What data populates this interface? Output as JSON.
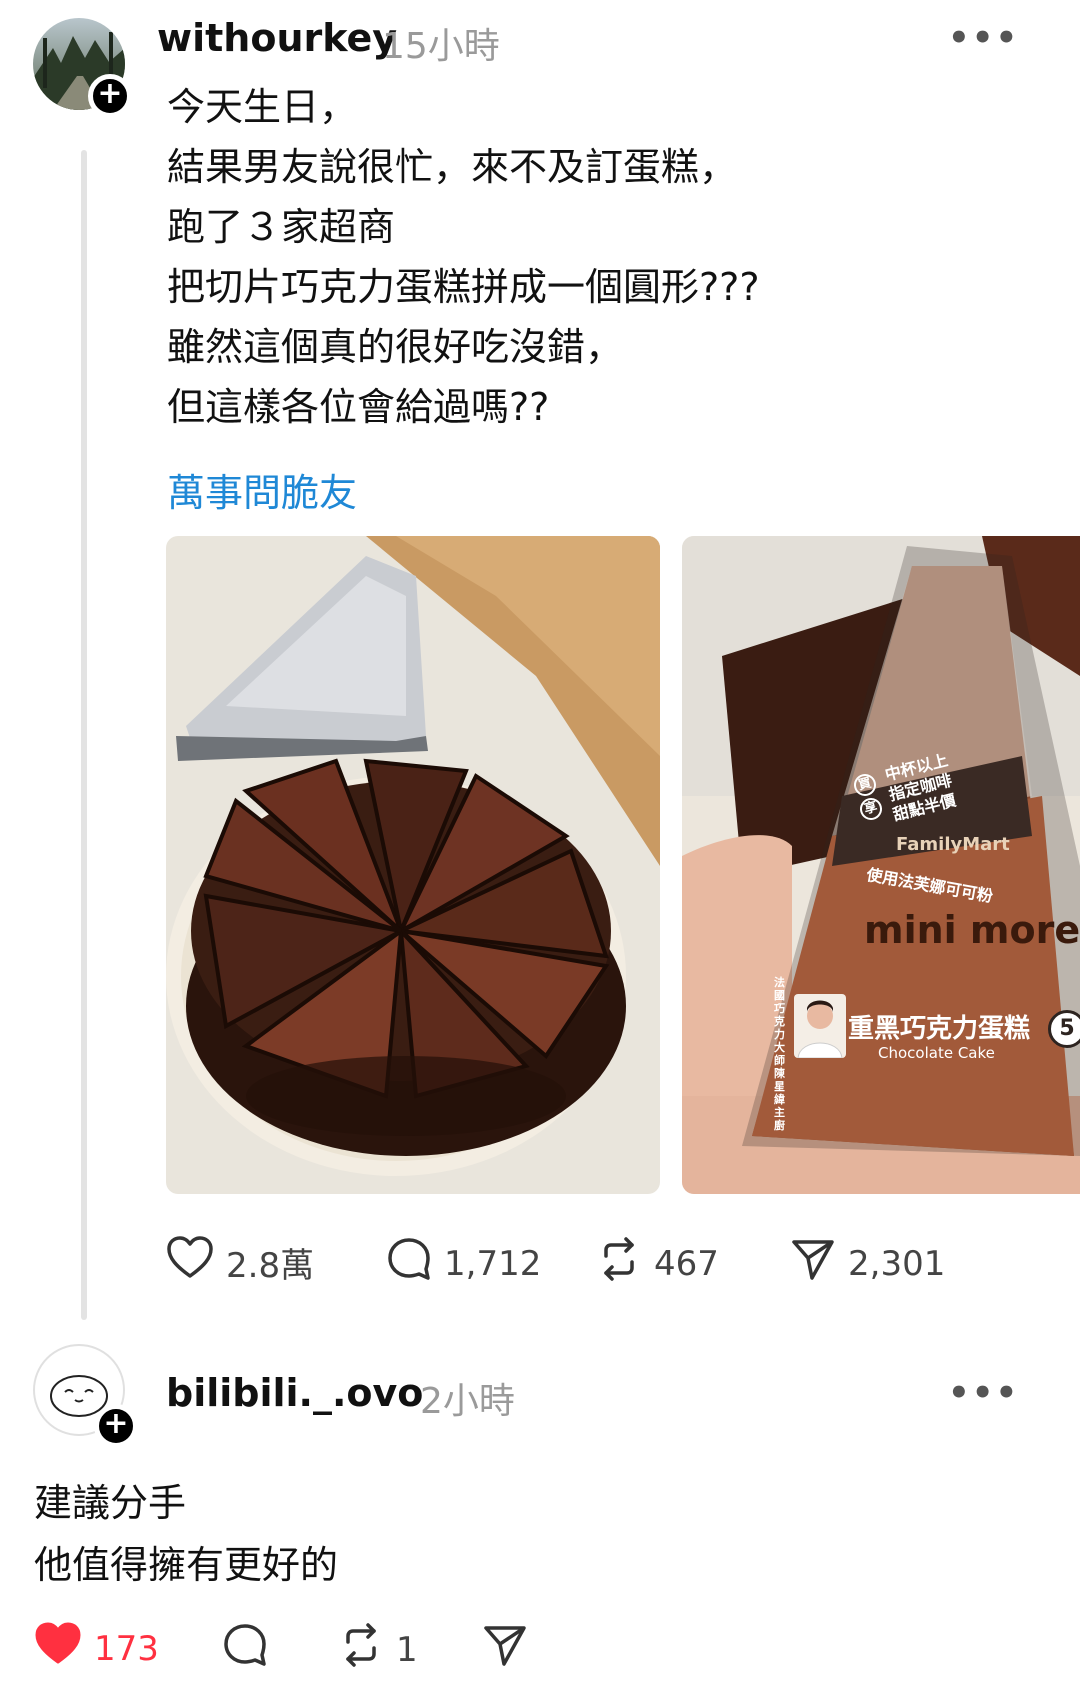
{
  "post": {
    "username": "withourkey",
    "time": "15小時",
    "lines": [
      "今天生日，",
      "結果男友說很忙，來不及訂蛋糕，",
      "跑了３家超商",
      "把切片巧克力蛋糕拼成一個圓形???",
      "雖然這個真的很好吃沒錯，",
      "但這樣各位會給過嗎??"
    ],
    "tag": "萬事問脆友",
    "photo2": {
      "package_brand": "FamilyMart",
      "package_promo": [
        "中杯以上",
        "指定咖啡",
        "甜點半價"
      ],
      "package_promo_badges": [
        "買",
        "享"
      ],
      "package_cocoa": "使用法芙娜可可粉",
      "package_series": "mini more",
      "package_chef": "法國巧克力大師 陳星緯 主廚",
      "package_name": "重黑巧克力蛋糕",
      "package_name_en": "Chocolate Cake",
      "package_price": "5"
    },
    "likes": "2.8萬",
    "comments": "1,712",
    "reposts": "467",
    "shares": "2,301"
  },
  "reply": {
    "username": "bilibili._.ovo",
    "time": "2小時",
    "lines": [
      "建議分手",
      "他值得擁有更好的"
    ],
    "likes": "173",
    "reposts": "1"
  },
  "colors": {
    "accent_link": "#1f88d6",
    "like_active": "#ff3040",
    "muted": "#9a9a9a"
  },
  "icons": {
    "more": "more-icon",
    "like": "heart-icon",
    "comment": "comment-icon",
    "repost": "repost-icon",
    "share": "send-icon",
    "follow": "plus-icon"
  }
}
